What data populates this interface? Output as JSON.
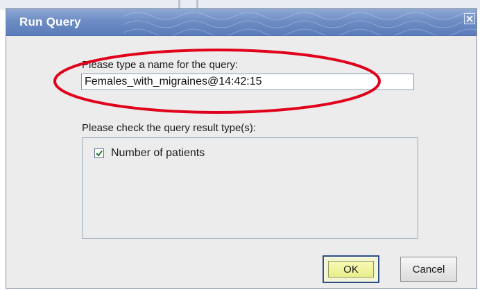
{
  "dialog": {
    "title": "Run Query",
    "close_icon": "close-icon"
  },
  "query_name": {
    "label": "Please type a name for the query:",
    "value": "Females_with_migraines@14:42:15"
  },
  "result_types": {
    "label": "Please check the query result type(s):",
    "items": [
      {
        "label": "Number of patients",
        "checked": true
      }
    ]
  },
  "buttons": {
    "ok_label": "OK",
    "cancel_label": "Cancel"
  },
  "colors": {
    "title_bar": "#6d8cc4",
    "highlight_ellipse": "#e0001b",
    "ok_button": "#eef19a"
  }
}
